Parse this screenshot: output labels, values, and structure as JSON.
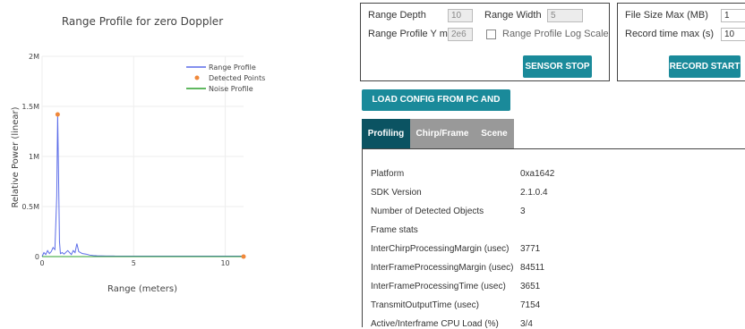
{
  "chart_data": {
    "type": "line",
    "title": "Range Profile for zero Doppler",
    "xlabel": "Range (meters)",
    "ylabel": "Relative Power (linear)",
    "xlim": [
      0,
      11
    ],
    "ylim": [
      0,
      2000000
    ],
    "x_ticks": [
      "0",
      "5",
      "10"
    ],
    "y_ticks": [
      "0",
      "0.5M",
      "1M",
      "1.5M",
      "2M"
    ],
    "legend": [
      "Range Profile",
      "Detected Points",
      "Noise Profile"
    ],
    "legend_position": "top-right",
    "colors": {
      "range_profile": "#5b6ce8",
      "detected_points": "#f0883a",
      "noise_profile": "#2ca02c"
    },
    "series": [
      {
        "name": "Range Profile",
        "x": [
          0,
          0.1,
          0.2,
          0.3,
          0.4,
          0.5,
          0.6,
          0.7,
          0.8,
          0.85,
          0.9,
          0.95,
          1.0,
          1.1,
          1.2,
          1.4,
          1.6,
          1.7,
          1.8,
          1.9,
          2.0,
          2.1,
          2.2,
          2.4,
          2.6,
          2.8,
          3.0,
          3.5,
          4,
          5,
          6,
          7,
          8,
          9,
          10,
          11
        ],
        "y": [
          0,
          40000,
          20000,
          60000,
          30000,
          50000,
          90000,
          70000,
          600000,
          1420000,
          800000,
          150000,
          30000,
          40000,
          25000,
          60000,
          20000,
          60000,
          40000,
          130000,
          50000,
          40000,
          30000,
          25000,
          15000,
          10000,
          8000,
          6000,
          5000,
          5000,
          5000,
          5000,
          5000,
          5000,
          5000,
          5000
        ]
      },
      {
        "name": "Detected Points",
        "x": [
          0.85,
          11
        ],
        "y": [
          1420000,
          0
        ]
      },
      {
        "name": "Noise Profile",
        "x": [
          0,
          11
        ],
        "y": [
          0,
          0
        ]
      }
    ]
  },
  "sensor": {
    "range_depth_label": "Range Depth",
    "range_depth_value": "10",
    "range_width_label": "Range Width",
    "range_width_value": "5",
    "profile_ymax_label": "Range Profile Y max",
    "profile_ymax_value": "2e6",
    "log_scale_label": "Range Profile Log Scale",
    "stop_button": "SENSOR STOP"
  },
  "record": {
    "file_size_label": "File Size Max (MB)",
    "file_size_value": "1",
    "record_time_label": "Record time max (s)",
    "record_time_value": "10",
    "start_button": "RECORD START"
  },
  "load_config_button": "LOAD CONFIG FROM PC AND SEND",
  "tabs": [
    {
      "label": "Profiling"
    },
    {
      "label": "Chirp/Frame"
    },
    {
      "label": "Scene"
    }
  ],
  "stats": [
    {
      "label": "Platform",
      "value": "0xa1642"
    },
    {
      "label": "SDK Version",
      "value": "2.1.0.4"
    },
    {
      "label": "Number of Detected Objects",
      "value": "3"
    },
    {
      "label": "Frame stats",
      "value": ""
    },
    {
      "label": "InterChirpProcessingMargin (usec)",
      "value": "3771"
    },
    {
      "label": "InterFrameProcessingMargin (usec)",
      "value": "84511"
    },
    {
      "label": "InterFrameProcessingTime (usec)",
      "value": "3651"
    },
    {
      "label": "TransmitOutputTime (usec)",
      "value": "7154"
    },
    {
      "label": "Active/Interframe CPU Load (%)",
      "value": "3/4"
    }
  ]
}
